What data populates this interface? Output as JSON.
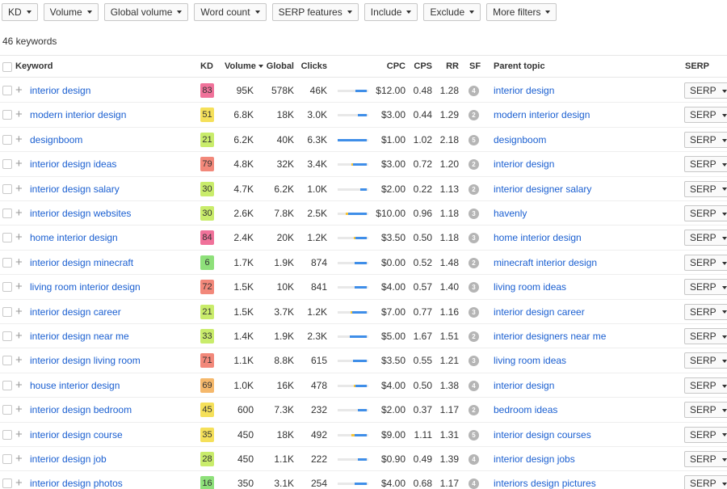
{
  "filters": [
    {
      "label": "KD"
    },
    {
      "label": "Volume"
    },
    {
      "label": "Global volume"
    },
    {
      "label": "Word count"
    },
    {
      "label": "SERP features"
    },
    {
      "label": "Include"
    },
    {
      "label": "Exclude"
    },
    {
      "label": "More filters"
    }
  ],
  "keyword_count": "46 keywords",
  "table": {
    "headers": {
      "keyword": "Keyword",
      "kd": "KD",
      "volume": "Volume",
      "global": "Global",
      "clicks": "Clicks",
      "cpc": "CPC",
      "cps": "CPS",
      "rr": "RR",
      "sf": "SF",
      "parent_topic": "Parent topic",
      "serp": "SERP"
    },
    "serp_button_label": "SERP",
    "kd_colors": {
      "very_easy": "#8ee07a",
      "easy": "#c9ec6b",
      "medium": "#f5e05a",
      "hard": "#f5b86b",
      "super_hard": "#f2887a",
      "extreme": "#f0729a"
    },
    "click_colors": {
      "organic": "#3f8ee8",
      "paid": "#f5c53a",
      "other": "#c08ae5"
    },
    "rows": [
      {
        "keyword": "interior design",
        "kd": "83",
        "kd_level": "extreme",
        "volume": "95K",
        "global": "578K",
        "clicks": "46K",
        "clicks_organic_pct": 38,
        "clicks_paid_pct": 0,
        "cpc": "$12.00",
        "cps": "0.48",
        "rr": "1.28",
        "sf": "4",
        "parent_topic": "interior design"
      },
      {
        "keyword": "modern interior design",
        "kd": "51",
        "kd_level": "medium",
        "volume": "6.8K",
        "global": "18K",
        "clicks": "3.0K",
        "clicks_organic_pct": 30,
        "clicks_paid_pct": 0,
        "cpc": "$3.00",
        "cps": "0.44",
        "rr": "1.29",
        "sf": "2",
        "parent_topic": "modern interior design"
      },
      {
        "keyword": "designboom",
        "kd": "21",
        "kd_level": "easy",
        "volume": "6.2K",
        "global": "40K",
        "clicks": "6.3K",
        "clicks_organic_pct": 95,
        "clicks_paid_pct": 0,
        "cpc": "$1.00",
        "cps": "1.02",
        "rr": "2.18",
        "sf": "5",
        "parent_topic": "designboom"
      },
      {
        "keyword": "interior design ideas",
        "kd": "79",
        "kd_level": "super_hard",
        "volume": "4.8K",
        "global": "32K",
        "clicks": "3.4K",
        "clicks_organic_pct": 45,
        "clicks_paid_pct": 5,
        "cpc": "$3.00",
        "cps": "0.72",
        "rr": "1.20",
        "sf": "2",
        "parent_topic": "interior design"
      },
      {
        "keyword": "interior design salary",
        "kd": "30",
        "kd_level": "easy",
        "volume": "4.7K",
        "global": "6.2K",
        "clicks": "1.0K",
        "clicks_organic_pct": 22,
        "clicks_paid_pct": 0,
        "cpc": "$2.00",
        "cps": "0.22",
        "rr": "1.13",
        "sf": "2",
        "parent_topic": "interior designer salary"
      },
      {
        "keyword": "interior design websites",
        "kd": "30",
        "kd_level": "easy",
        "volume": "2.6K",
        "global": "7.8K",
        "clicks": "2.5K",
        "clicks_organic_pct": 60,
        "clicks_paid_pct": 8,
        "cpc": "$10.00",
        "cps": "0.96",
        "rr": "1.18",
        "sf": "3",
        "parent_topic": "havenly"
      },
      {
        "keyword": "home interior design",
        "kd": "84",
        "kd_level": "extreme",
        "volume": "2.4K",
        "global": "20K",
        "clicks": "1.2K",
        "clicks_organic_pct": 38,
        "clicks_paid_pct": 5,
        "cpc": "$3.50",
        "cps": "0.50",
        "rr": "1.18",
        "sf": "3",
        "parent_topic": "home interior design"
      },
      {
        "keyword": "interior design minecraft",
        "kd": "6",
        "kd_level": "very_easy",
        "volume": "1.7K",
        "global": "1.9K",
        "clicks": "874",
        "clicks_organic_pct": 40,
        "clicks_paid_pct": 0,
        "cpc": "$0.00",
        "cps": "0.52",
        "rr": "1.48",
        "sf": "2",
        "parent_topic": "minecraft interior design"
      },
      {
        "keyword": "living room interior design",
        "kd": "72",
        "kd_level": "super_hard",
        "volume": "1.5K",
        "global": "10K",
        "clicks": "841",
        "clicks_organic_pct": 40,
        "clicks_paid_pct": 0,
        "cpc": "$4.00",
        "cps": "0.57",
        "rr": "1.40",
        "sf": "3",
        "parent_topic": "living room ideas"
      },
      {
        "keyword": "interior design career",
        "kd": "21",
        "kd_level": "easy",
        "volume": "1.5K",
        "global": "3.7K",
        "clicks": "1.2K",
        "clicks_organic_pct": 48,
        "clicks_paid_pct": 5,
        "cpc": "$7.00",
        "cps": "0.77",
        "rr": "1.16",
        "sf": "3",
        "parent_topic": "interior design career"
      },
      {
        "keyword": "interior design near me",
        "kd": "33",
        "kd_level": "easy",
        "volume": "1.4K",
        "global": "1.9K",
        "clicks": "2.3K",
        "clicks_organic_pct": 55,
        "clicks_paid_pct": 0,
        "cpc": "$5.00",
        "cps": "1.67",
        "rr": "1.51",
        "sf": "2",
        "parent_topic": "interior designers near me"
      },
      {
        "keyword": "interior design living room",
        "kd": "71",
        "kd_level": "super_hard",
        "volume": "1.1K",
        "global": "8.8K",
        "clicks": "615",
        "clicks_organic_pct": 45,
        "clicks_paid_pct": 0,
        "cpc": "$3.50",
        "cps": "0.55",
        "rr": "1.21",
        "sf": "3",
        "parent_topic": "living room ideas"
      },
      {
        "keyword": "house interior design",
        "kd": "69",
        "kd_level": "hard",
        "volume": "1.0K",
        "global": "16K",
        "clicks": "478",
        "clicks_organic_pct": 38,
        "clicks_paid_pct": 5,
        "cpc": "$4.00",
        "cps": "0.50",
        "rr": "1.38",
        "sf": "4",
        "parent_topic": "interior design"
      },
      {
        "keyword": "interior design bedroom",
        "kd": "45",
        "kd_level": "medium",
        "volume": "600",
        "global": "7.3K",
        "clicks": "232",
        "clicks_organic_pct": 30,
        "clicks_paid_pct": 0,
        "cpc": "$2.00",
        "cps": "0.37",
        "rr": "1.17",
        "sf": "2",
        "parent_topic": "bedroom ideas"
      },
      {
        "keyword": "interior design course",
        "kd": "35",
        "kd_level": "medium",
        "volume": "450",
        "global": "18K",
        "clicks": "492",
        "clicks_organic_pct": 40,
        "clicks_paid_pct": 10,
        "cpc": "$9.00",
        "cps": "1.11",
        "rr": "1.31",
        "sf": "5",
        "parent_topic": "interior design courses"
      },
      {
        "keyword": "interior design job",
        "kd": "28",
        "kd_level": "easy",
        "volume": "450",
        "global": "1.1K",
        "clicks": "222",
        "clicks_organic_pct": 30,
        "clicks_paid_pct": 0,
        "cpc": "$0.90",
        "cps": "0.49",
        "rr": "1.39",
        "sf": "4",
        "parent_topic": "interior design jobs"
      },
      {
        "keyword": "interior design photos",
        "kd": "16",
        "kd_level": "very_easy",
        "volume": "350",
        "global": "3.1K",
        "clicks": "254",
        "clicks_organic_pct": 40,
        "clicks_paid_pct": 0,
        "cpc": "$4.00",
        "cps": "0.68",
        "rr": "1.17",
        "sf": "4",
        "parent_topic": "interiors design pictures"
      }
    ]
  }
}
